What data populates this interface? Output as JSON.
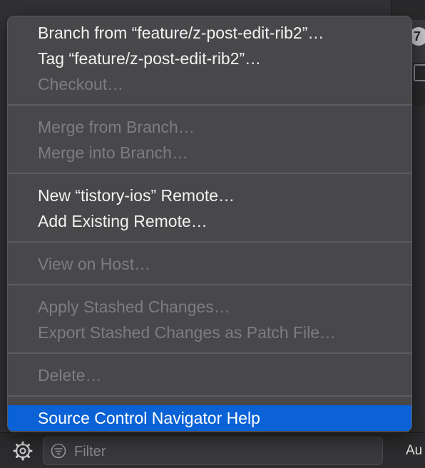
{
  "menu": {
    "items": [
      {
        "label": "Branch from “feature/z-post-edit-rib2”…",
        "enabled": true
      },
      {
        "label": "Tag “feature/z-post-edit-rib2”…",
        "enabled": true
      },
      {
        "label": "Checkout…",
        "enabled": false
      },
      {
        "label": "Merge from Branch…",
        "enabled": false
      },
      {
        "label": "Merge into Branch…",
        "enabled": false
      },
      {
        "label": "New “tistory-ios” Remote…",
        "enabled": true
      },
      {
        "label": "Add Existing Remote…",
        "enabled": true
      },
      {
        "label": "View on Host…",
        "enabled": false
      },
      {
        "label": "Apply Stashed Changes…",
        "enabled": false
      },
      {
        "label": "Export Stashed Changes as Patch File…",
        "enabled": false
      },
      {
        "label": "Delete…",
        "enabled": false
      },
      {
        "label": "Source Control Navigator Help",
        "enabled": true,
        "highlighted": true
      }
    ]
  },
  "bottom_bar": {
    "filter_placeholder": "Filter",
    "right_label": "Au",
    "icons": [
      "gear-icon",
      "filter-icon"
    ]
  },
  "background": {
    "badge_text": "7"
  },
  "colors": {
    "highlight": "#0a62d6",
    "menu_background": "#48484b",
    "disabled_text": "#7d7d80"
  }
}
